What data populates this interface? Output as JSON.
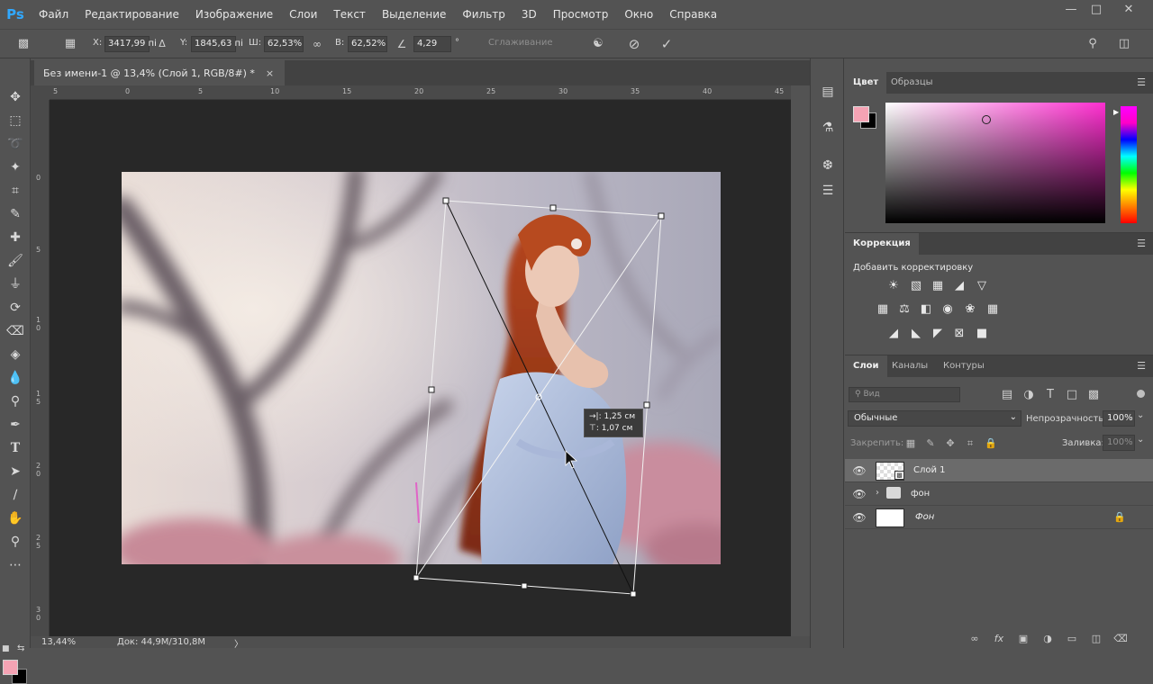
{
  "app": {
    "logo": "Ps"
  },
  "menu": [
    "Файл",
    "Редактирование",
    "Изображение",
    "Слои",
    "Текст",
    "Выделение",
    "Фильтр",
    "3D",
    "Просмотр",
    "Окно",
    "Справка"
  ],
  "options_bar": {
    "x_label": "X:",
    "x_value": "3417,99 пі",
    "y_label": "Y:",
    "y_value": "1845,63 пі",
    "w_label": "Ш:",
    "w_value": "62,53%",
    "h_label": "В:",
    "h_value": "62,52%",
    "angle_value": "4,29",
    "angle_unit": "°",
    "antialias_label": "Сглаживание"
  },
  "document": {
    "tab_title": "Без имени-1 @ 13,4% (Слой 1, RGB/8#) *",
    "close_symbol": "×",
    "ruler_h": [
      "5",
      "0",
      "5",
      "10",
      "15",
      "20",
      "25",
      "30",
      "35",
      "40",
      "45"
    ],
    "ruler_v": [
      "0",
      "5",
      "1\n0",
      "1\n5",
      "2\n0",
      "2\n5",
      "3\n0"
    ],
    "transform_tooltip": {
      "line1": "→|: 1,25 см",
      "line2": "⊤: 1,07 см"
    },
    "zoom": "13,44%",
    "doc_size": "Док: 44,9M/310,8M",
    "status_arrow": "〉"
  },
  "color_panel": {
    "tabs": [
      "Цвет",
      "Образцы"
    ],
    "foreground": "#f5a3b4",
    "background": "#000000",
    "hue": "#ff2fd0"
  },
  "adjustments_panel": {
    "tab": "Коррекция",
    "subtitle": "Добавить корректировку",
    "row1_icons": [
      "brightness-icon",
      "levels-icon",
      "curves-icon",
      "exposure-icon",
      "vibrance-icon"
    ],
    "row2_icons": [
      "hue-saturation-icon",
      "color-balance-icon",
      "black-white-icon",
      "photo-filter-icon",
      "channel-mixer-icon",
      "color-lookup-icon"
    ],
    "row3_icons": [
      "invert-icon",
      "posterize-icon",
      "threshold-icon",
      "selective-color-icon",
      "gradient-map-icon"
    ]
  },
  "layers_panel": {
    "tabs": [
      "Слои",
      "Каналы",
      "Контуры"
    ],
    "filter_placeholder": "Вид",
    "blend_mode": "Обычные",
    "opacity_label": "Непрозрачность:",
    "opacity_value": "100%",
    "lock_label": "Закрепить:",
    "fill_label": "Заливка:",
    "fill_value": "100%",
    "layers": [
      {
        "name": "Слой 1",
        "selected": true
      },
      {
        "name": "фон",
        "group": true
      },
      {
        "name": "Фон",
        "locked": true
      }
    ]
  },
  "colors": {
    "app_bg": "#535353",
    "canvas_bg": "#282828",
    "accent": "#31a8ff"
  }
}
